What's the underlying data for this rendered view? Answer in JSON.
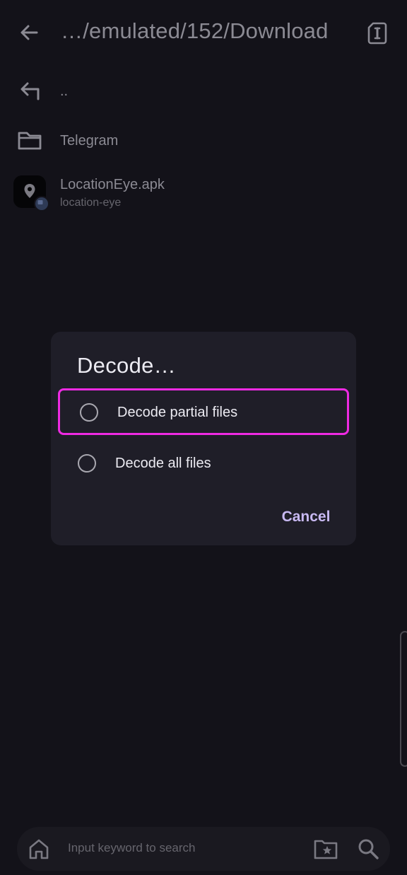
{
  "header": {
    "path": "…/emulated/152/Download"
  },
  "files": [
    {
      "name": "..",
      "icon": "parent-folder-icon"
    },
    {
      "name": "Telegram",
      "icon": "folder-icon"
    },
    {
      "name": "LocationEye.apk",
      "subtitle": "location-eye",
      "icon": "apk-location-icon"
    }
  ],
  "search": {
    "placeholder": "Input keyword to search"
  },
  "dialog": {
    "title": "Decode…",
    "options": [
      {
        "label": "Decode partial files",
        "selected": false
      },
      {
        "label": "Decode all files",
        "selected": false
      }
    ],
    "cancel_label": "Cancel"
  },
  "colors": {
    "background": "#131219",
    "dialog_bg": "#1f1e28",
    "accent": "#c8b9f2",
    "highlight": "#ee2ae2"
  }
}
